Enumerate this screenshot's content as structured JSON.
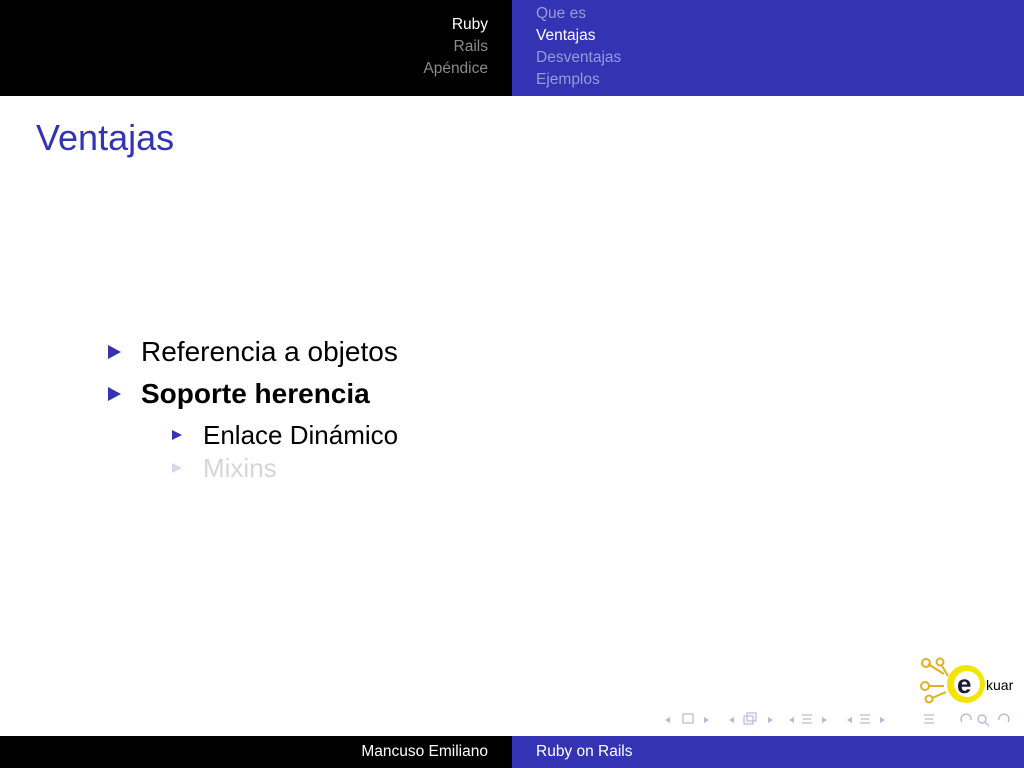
{
  "header": {
    "sections": [
      {
        "label": "Ruby",
        "active": true
      },
      {
        "label": "Rails",
        "active": false
      },
      {
        "label": "Apéndice",
        "active": false
      }
    ],
    "subsections": [
      {
        "label": "Que es",
        "active": false
      },
      {
        "label": "Ventajas",
        "active": true
      },
      {
        "label": "Desventajas",
        "active": false
      },
      {
        "label": "Ejemplos",
        "active": false
      }
    ]
  },
  "slide": {
    "title": "Ventajas",
    "items": [
      {
        "text": "Referencia a objetos",
        "level": 1
      },
      {
        "text": "Soporte herencia",
        "level": 1,
        "emphasis": "bold"
      },
      {
        "text": "Enlace Dinámico",
        "level": 2
      },
      {
        "text": "Mixins",
        "level": 2,
        "state": "dimmed"
      }
    ]
  },
  "logo": {
    "text": "kuar",
    "letter": "e",
    "accent": "#f2e600",
    "node_color": "#e0b020"
  },
  "footer": {
    "author": "Mancuso Emiliano",
    "title": "Ruby on Rails"
  },
  "colors": {
    "theme": "#3333b3",
    "dark": "#000000",
    "dimmed": "#d6d6d6"
  }
}
